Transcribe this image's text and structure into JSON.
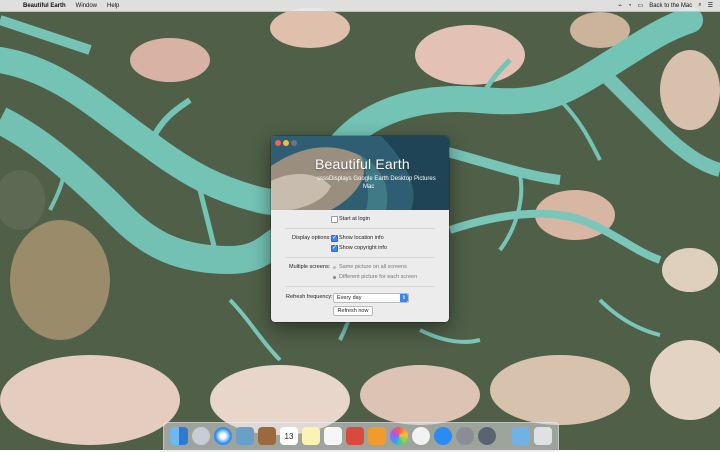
{
  "menubar": {
    "app_name": "Beautiful Earth",
    "items": [
      "Window",
      "Help"
    ],
    "right_label": "Back to the Mac",
    "apple_glyph": "",
    "status_glyphs": [
      "⌁",
      "◔",
      "▭",
      "⌕",
      "☰"
    ]
  },
  "window": {
    "title": "Beautiful Earth",
    "subtitle_line1": "ssssDisplays Google Earth Desktop Pictures",
    "subtitle_line2": "Mac",
    "start_at_login_label": "Start at login",
    "start_at_login": false,
    "display_options_label": "Display options:",
    "show_location_label": "Show location info",
    "show_location": true,
    "show_copyright_label": "Show copyright info",
    "show_copyright": true,
    "multiple_screens_label": "Multiple screens:",
    "same_picture_label": "Same picture on all screens",
    "different_picture_label": "Different picture for each screen",
    "refresh_frequency_label": "Refresh frequency:",
    "refresh_frequency_value": "Every day",
    "refresh_now_label": "Refresh now"
  },
  "dock": {
    "apps": [
      "finder-icon",
      "launchpad-icon",
      "safari-icon",
      "photos-viewer-icon",
      "notes-book-icon",
      "calendar-icon",
      "notes-icon",
      "reminders-icon",
      "photo-booth-icon",
      "books-icon",
      "photos-icon",
      "itunes-icon",
      "app-store-icon",
      "system-preferences-icon",
      "disk-utility-icon",
      "downloads-folder-icon",
      "trash-icon"
    ],
    "calendar_day": "13"
  },
  "colors": {
    "water": "#6fc2b5",
    "land": "#4a5b45",
    "sand": "#d9b9a8",
    "accent": "#3b86f6"
  }
}
